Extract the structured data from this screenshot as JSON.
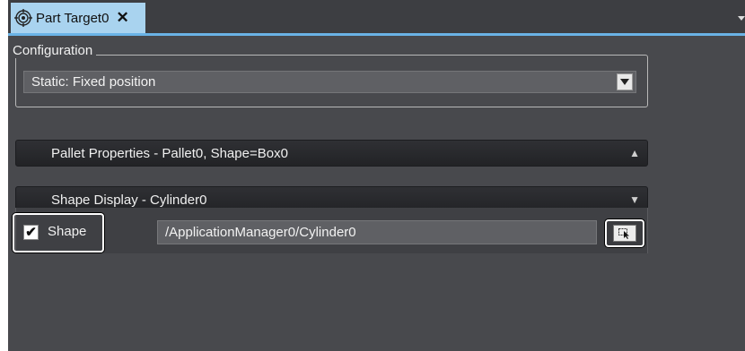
{
  "tab": {
    "title": "Part Target0",
    "close_label": "✕",
    "icon": "target-icon"
  },
  "configuration": {
    "legend": "Configuration",
    "selected": "Static: Fixed position"
  },
  "sections": {
    "pallet": {
      "label": "Pallet Properties - Pallet0, Shape=Box0",
      "state": "collapsed",
      "arrow": "▲"
    },
    "shape_display": {
      "label": "Shape Display - Cylinder0",
      "state": "expanded",
      "arrow": "▼"
    }
  },
  "shape": {
    "label": "Shape",
    "checked": true,
    "check_glyph": "✔",
    "path": "/ApplicationManager0/Cylinder0",
    "browse_icon": "cursor-select-icon"
  },
  "colors": {
    "background": "#48494d",
    "tab_active": "#a9d3ef",
    "tab_accent": "#6ab3e6"
  }
}
